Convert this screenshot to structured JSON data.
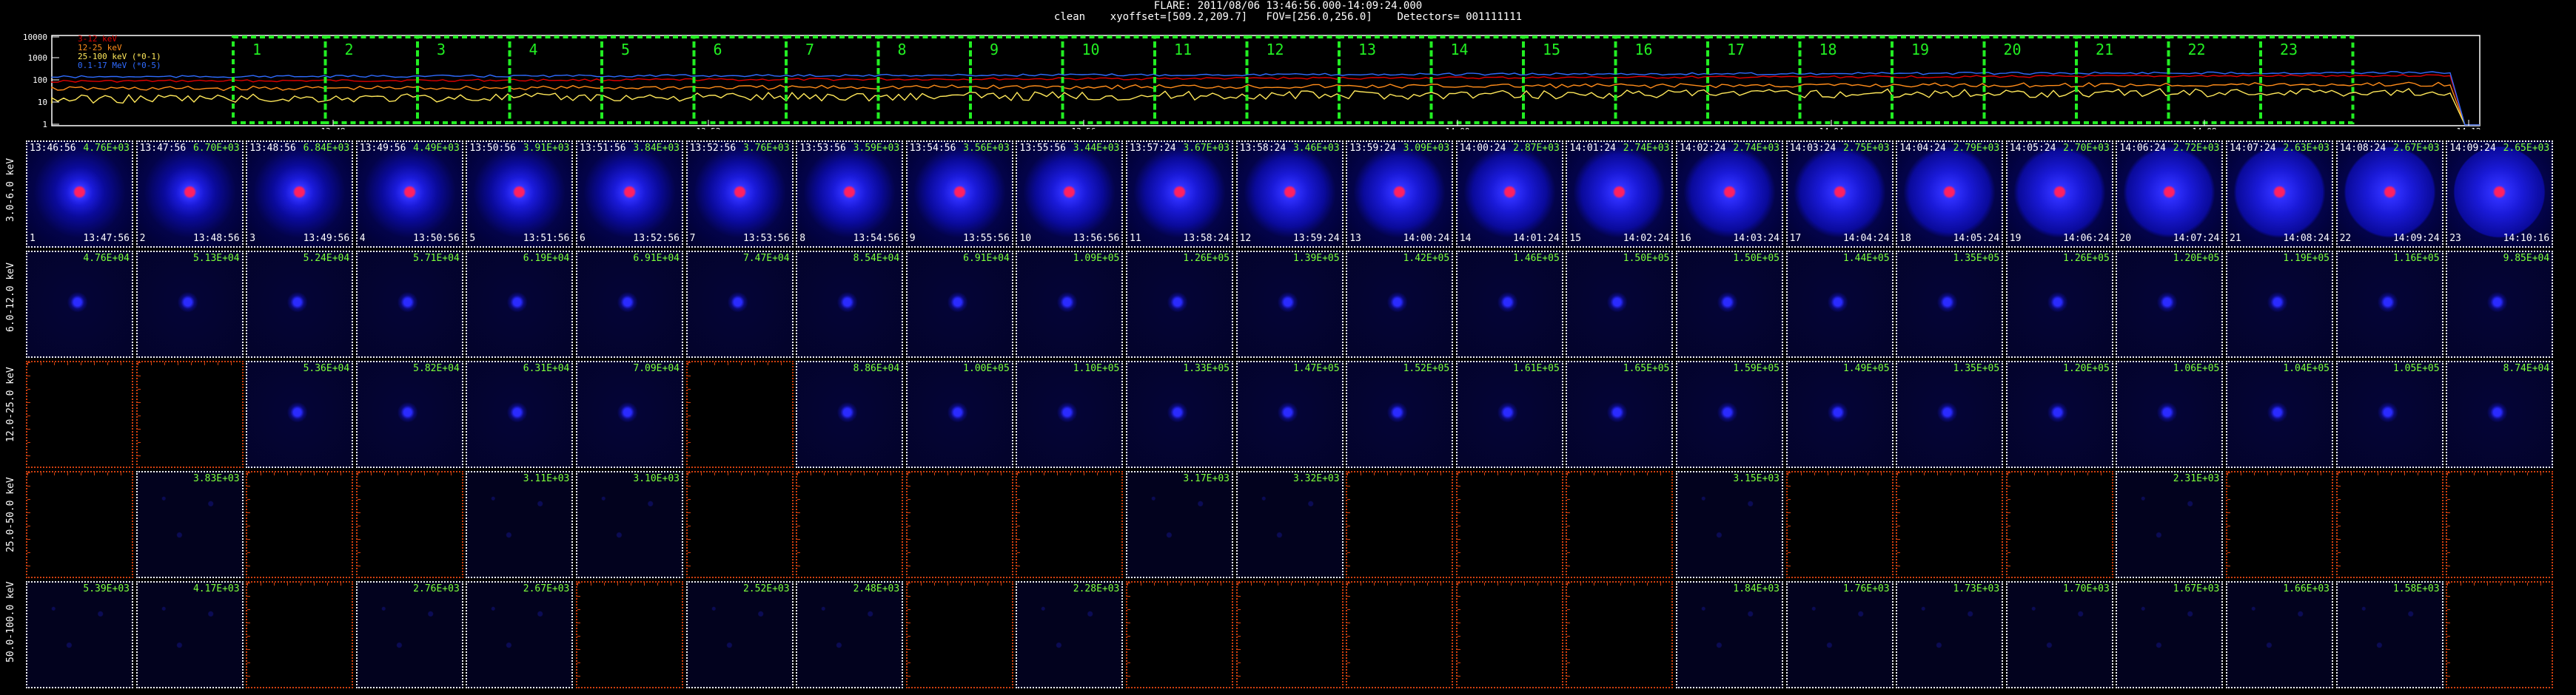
{
  "header": {
    "title": "FLARE: 2011/08/06 13:46:56.000-14:09:24.000",
    "info": "clean    xyoffset=[509.2,209.7]   FOV=[256.0,256.0]    Detectors= 001111111"
  },
  "lightcurve": {
    "yticks": [
      "10000",
      "1000",
      "100",
      "10",
      "1"
    ],
    "legend": [
      {
        "label": "3-12 keV",
        "color": "#e00000"
      },
      {
        "label": "12-25 keV",
        "color": "#ff8c1a"
      },
      {
        "label": "25-100 keV (*0-1)",
        "color": "#ffe85a"
      },
      {
        "label": "0.1-17 MeV (*0-5)",
        "color": "#2f6bff"
      }
    ],
    "xticks": [
      "13:48",
      "13:52",
      "13:56",
      "14:00",
      "14:04",
      "14:08",
      "14:12"
    ],
    "boxes": [
      "1",
      "2",
      "3",
      "4",
      "5",
      "6",
      "7",
      "8",
      "9",
      "10",
      "11",
      "12",
      "13",
      "14",
      "15",
      "16",
      "17",
      "18",
      "19",
      "20",
      "21",
      "22",
      "23"
    ],
    "series_colors": [
      "#e00000",
      "#ff8c1a",
      "#ffe85a",
      "#2f6bff"
    ]
  },
  "energy_bands": [
    "3.0-6.0 keV",
    "6.0-12.0 keV",
    "12.0-25.0 keV",
    "25.0-50.0 keV",
    "50.0-100.0 keV"
  ],
  "times_start": [
    "13:46:56",
    "13:47:56",
    "13:48:56",
    "13:49:56",
    "13:50:56",
    "13:51:56",
    "13:52:56",
    "13:53:56",
    "13:54:56",
    "13:55:56",
    "13:57:24",
    "13:58:24",
    "13:59:24",
    "14:00:24",
    "14:01:24",
    "14:02:24",
    "14:03:24",
    "14:04:24",
    "14:05:24",
    "14:06:24",
    "14:07:24",
    "14:08:24",
    "14:09:24"
  ],
  "times_end": [
    "13:47:56",
    "13:48:56",
    "13:49:56",
    "13:50:56",
    "13:51:56",
    "13:52:56",
    "13:53:56",
    "13:54:56",
    "13:55:56",
    "13:56:56",
    "13:58:24",
    "13:59:24",
    "14:00:24",
    "14:01:24",
    "14:02:24",
    "14:03:24",
    "14:04:24",
    "14:05:24",
    "14:06:24",
    "14:07:24",
    "14:08:24",
    "14:09:24",
    "14:10:16"
  ],
  "rows": [
    [
      "4.76E+03",
      "6.70E+03",
      "6.84E+03",
      "4.49E+03",
      "3.91E+03",
      "3.84E+03",
      "3.76E+03",
      "3.59E+03",
      "3.56E+03",
      "3.44E+03",
      "3.67E+03",
      "3.46E+03",
      "3.09E+03",
      "2.87E+03",
      "2.74E+03",
      "2.74E+03",
      "2.75E+03",
      "2.79E+03",
      "2.70E+03",
      "2.72E+03",
      "2.63E+03",
      "2.67E+03",
      "2.65E+03"
    ],
    [
      "4.76E+04",
      "5.13E+04",
      "5.24E+04",
      "5.71E+04",
      "6.19E+04",
      "6.91E+04",
      "7.47E+04",
      "8.54E+04",
      "6.91E+04",
      "1.09E+05",
      "1.26E+05",
      "1.39E+05",
      "1.42E+05",
      "1.46E+05",
      "1.50E+05",
      "1.50E+05",
      "1.44E+05",
      "1.35E+05",
      "1.26E+05",
      "1.20E+05",
      "1.19E+05",
      "1.16E+05",
      "9.85E+04"
    ],
    [
      null,
      null,
      "5.36E+04",
      "5.82E+04",
      "6.31E+04",
      "7.09E+04",
      null,
      "8.86E+04",
      "1.00E+05",
      "1.10E+05",
      "1.33E+05",
      "1.47E+05",
      "1.52E+05",
      "1.61E+05",
      "1.65E+05",
      "1.59E+05",
      "1.49E+05",
      "1.35E+05",
      "1.20E+05",
      "1.06E+05",
      "1.04E+05",
      "1.05E+05",
      "8.74E+04"
    ],
    [
      null,
      "3.83E+03",
      null,
      null,
      "3.11E+03",
      "3.10E+03",
      null,
      null,
      null,
      null,
      "3.17E+03",
      "3.32E+03",
      null,
      null,
      null,
      "3.15E+03",
      null,
      null,
      null,
      "2.31E+03",
      null,
      null,
      null
    ],
    [
      "5.39E+03",
      "4.17E+03",
      null,
      "2.76E+03",
      "2.67E+03",
      null,
      "2.52E+03",
      "2.48E+03",
      null,
      "2.28E+03",
      null,
      null,
      null,
      null,
      null,
      "1.84E+03",
      "1.76E+03",
      "1.73E+03",
      "1.70E+03",
      "1.67E+03",
      "1.66E+03",
      "1.58E+03",
      null
    ]
  ]
}
